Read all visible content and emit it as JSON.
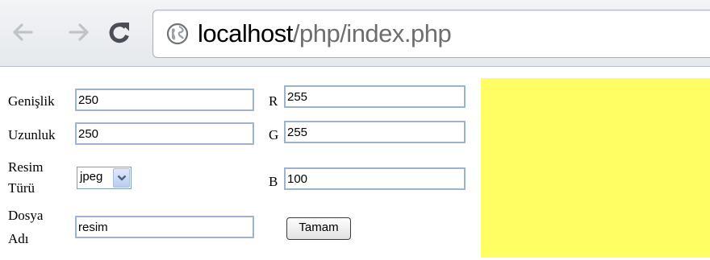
{
  "browser": {
    "url_host": "localhost",
    "url_path": "/php/index.php",
    "back_icon": "arrow-left-icon",
    "forward_icon": "arrow-right-icon",
    "reload_icon": "reload-icon",
    "site_icon": "globe-icon"
  },
  "form": {
    "width_label": "Genişlik",
    "width_value": "250",
    "height_label": "Uzunluk",
    "height_value": "250",
    "type_label_line1": "Resim",
    "type_label_line2": "Türü",
    "type_value": "jpeg",
    "filename_label_line1": "Dosya",
    "filename_label_line2": "Adı",
    "filename_value": "resim",
    "r_label": "R",
    "r_value": "255",
    "g_label": "G",
    "g_value": "255",
    "b_label": "B",
    "b_value": "100",
    "submit_label": "Tamam"
  },
  "preview": {
    "color": "#ffff64"
  }
}
